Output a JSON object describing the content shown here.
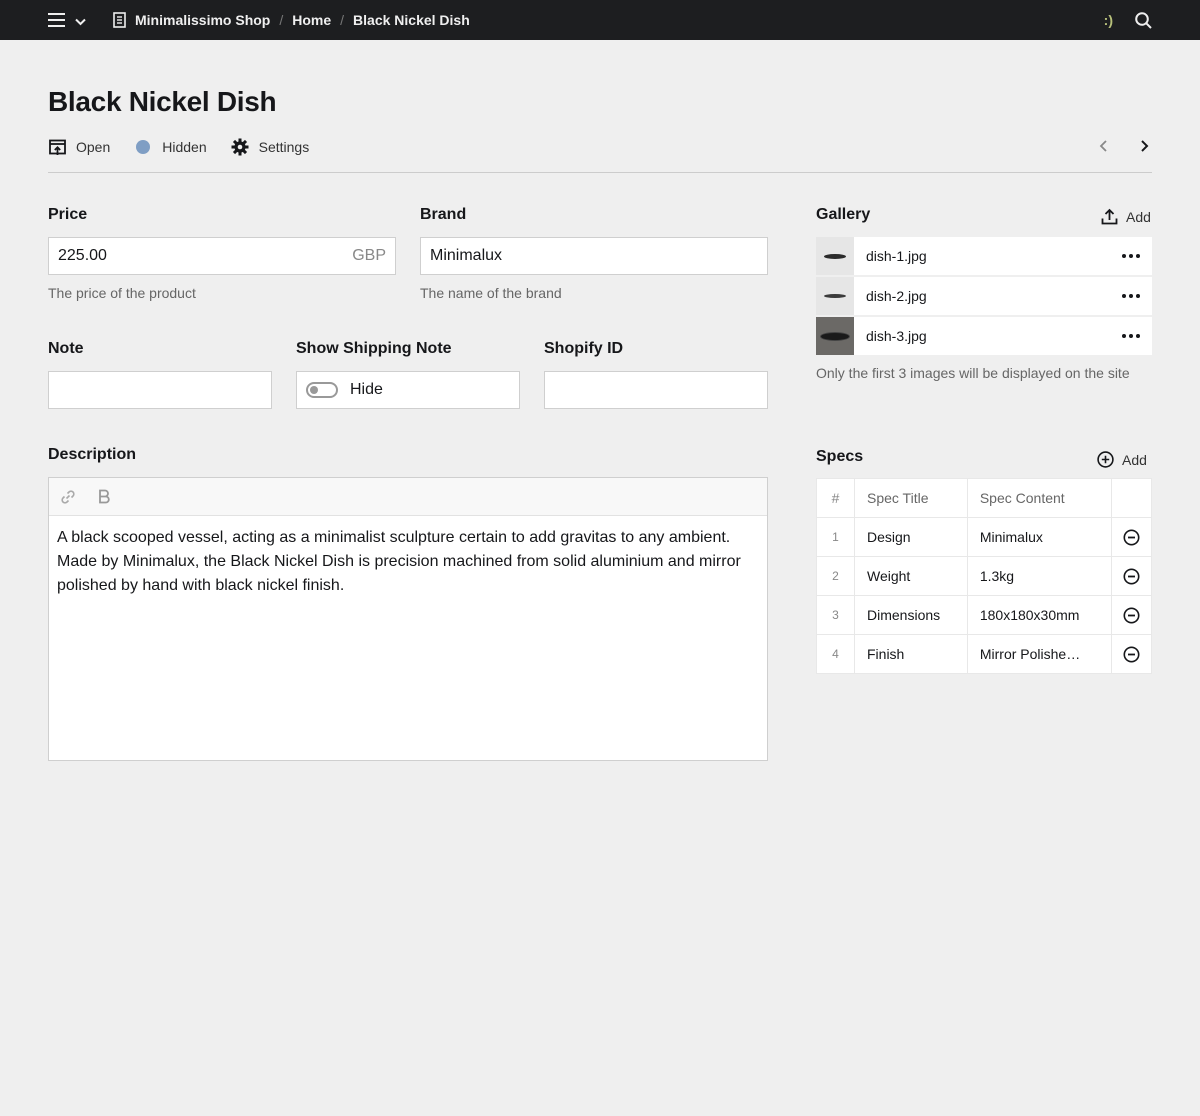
{
  "topbar": {
    "crumbs": [
      "Minimalissimo Shop",
      "Home",
      "Black Nickel Dish"
    ],
    "separator": "/",
    "user_indicator": ":)"
  },
  "page": {
    "title": "Black Nickel Dish",
    "toolbar": {
      "open": "Open",
      "status": "Hidden",
      "settings": "Settings"
    }
  },
  "fields": {
    "price": {
      "label": "Price",
      "value": "225.00",
      "unit": "GBP",
      "help": "The price of the product"
    },
    "brand": {
      "label": "Brand",
      "value": "Minimalux",
      "help": "The name of the brand"
    },
    "note": {
      "label": "Note",
      "value": ""
    },
    "shipping": {
      "label": "Show Shipping Note",
      "value": "Hide"
    },
    "shopify": {
      "label": "Shopify ID",
      "value": ""
    },
    "description": {
      "label": "Description",
      "text": "A black scooped vessel, acting as a minimalist sculpture certain to add gravitas to any ambient. Made by Minimalux, the Black Nickel Dish is precision machined from solid aluminium and mirror polished by hand with black nickel finish."
    }
  },
  "gallery": {
    "title": "Gallery",
    "add_label": "Add",
    "items": [
      "dish-1.jpg",
      "dish-2.jpg",
      "dish-3.jpg"
    ],
    "help": "Only the first 3 images will be displayed on the site"
  },
  "specs": {
    "title": "Specs",
    "add_label": "Add",
    "columns": [
      "#",
      "Spec Title",
      "Spec Content"
    ],
    "rows": [
      {
        "n": "1",
        "title": "Design",
        "content": "Minimalux"
      },
      {
        "n": "2",
        "title": "Weight",
        "content": "1.3kg"
      },
      {
        "n": "3",
        "title": "Dimensions",
        "content": "180x180x30mm"
      },
      {
        "n": "4",
        "title": "Finish",
        "content": "Mirror Polishe…"
      }
    ]
  },
  "colors": {
    "topbar": "#1d1e20",
    "status_hidden": "#7f9ec4",
    "background": "#efefef"
  }
}
